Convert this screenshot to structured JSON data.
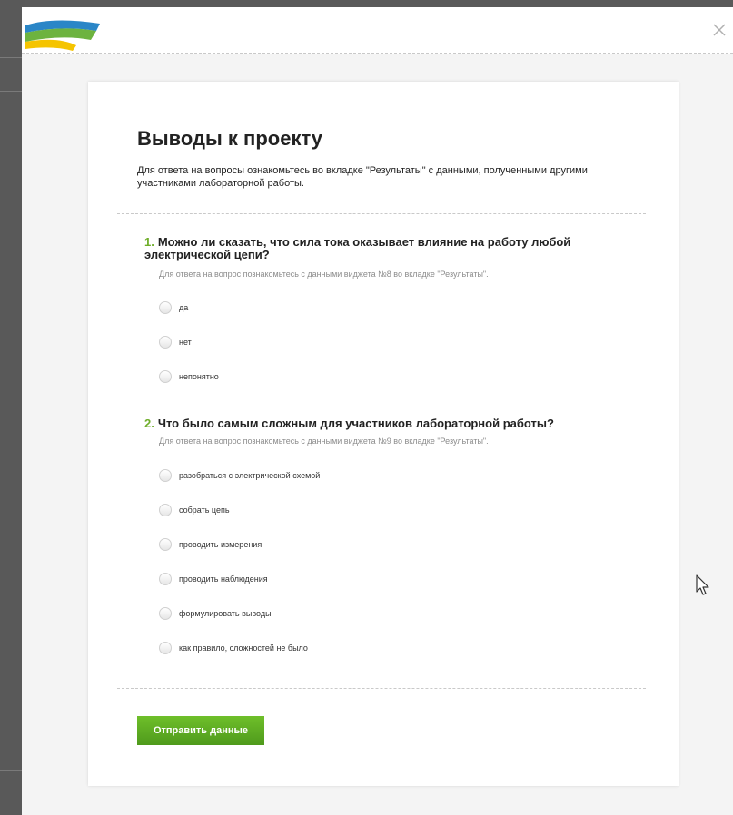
{
  "header": {
    "logo": "brand-logo",
    "close_icon": "close-icon"
  },
  "page": {
    "title": "Выводы к проекту",
    "intro": "Для ответа на вопросы ознакомьтесь во вкладке \"Результаты\" с данными, полученными другими участниками лабораторной работы."
  },
  "questions": [
    {
      "number": "1.",
      "text": "Можно ли сказать, что сила тока оказывает влияние на работу любой электрической цепи?",
      "hint": "Для ответа на вопрос познакомьтесь с данными виджета №8 во вкладке \"Результаты\".",
      "options": [
        "да",
        "нет",
        "непонятно"
      ]
    },
    {
      "number": "2.",
      "text": "Что было самым сложным для участников лабораторной работы?",
      "hint": "Для ответа на вопрос познакомьтесь с данными виджета №9 во вкладке \"Результаты\".",
      "options": [
        "разобраться с электрической схемой",
        "собрать цепь",
        "проводить измерения",
        "проводить наблюдения",
        "формулировать выводы",
        "как правило, сложностей не было"
      ]
    }
  ],
  "submit": {
    "label": "Отправить данные"
  },
  "colors": {
    "accent_green": "#6fae2a",
    "button_green": "#5aa820"
  }
}
